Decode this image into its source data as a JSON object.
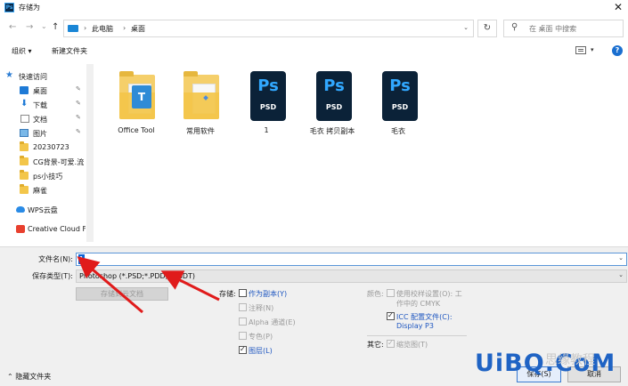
{
  "window": {
    "title": "存储为",
    "app_icon": "Ps",
    "close_glyph": "✕"
  },
  "nav": {
    "back": "←",
    "forward": "→",
    "recent": "⌄",
    "up": "↑"
  },
  "address": {
    "segments": [
      "此电脑",
      "桌面"
    ],
    "separator": "›",
    "dropdown": "⌄"
  },
  "refresh": "↻",
  "search": {
    "placeholder": "在 桌面 中搜索"
  },
  "toolbar": {
    "organize": "组织 ▾",
    "new_folder": "新建文件夹",
    "view_dropdown": "▾",
    "help": "?"
  },
  "sidebar": {
    "items": [
      {
        "label": "快速访问",
        "icon": "star-icon"
      },
      {
        "label": "桌面",
        "icon": "desktop-icon",
        "pinned": true
      },
      {
        "label": "下载",
        "icon": "download-icon",
        "pinned": true
      },
      {
        "label": "文档",
        "icon": "document-icon",
        "pinned": true
      },
      {
        "label": "图片",
        "icon": "picture-icon",
        "pinned": true
      },
      {
        "label": "20230723",
        "icon": "folder-icon"
      },
      {
        "label": "CG背景-可爱.流",
        "icon": "folder-icon"
      },
      {
        "label": "ps小技巧",
        "icon": "folder-icon"
      },
      {
        "label": "麻雀",
        "icon": "folder-icon"
      },
      {
        "label": "WPS云盘",
        "icon": "cloud-icon"
      },
      {
        "label": "Creative Cloud F",
        "icon": "creative-cloud-icon"
      }
    ],
    "pin_glyph": "📌"
  },
  "files": [
    {
      "name": "Office Tool",
      "type": "folder-app"
    },
    {
      "name": "常用软件",
      "type": "folder"
    },
    {
      "name": "1",
      "type": "psd"
    },
    {
      "name": "毛衣 拷贝副本",
      "type": "psd"
    },
    {
      "name": "毛衣",
      "type": "psd"
    }
  ],
  "psd_icon": {
    "ps": "Ps",
    "ext": "PSD",
    "color": "#31a8ff",
    "bg": "#0b2238"
  },
  "folder_badge": "T",
  "form": {
    "filename_label": "文件名(N):",
    "filename_value": "1",
    "filetype_label": "保存类型(T):",
    "filetype_value": "Photoshop (*.PSD;*.PDD;*.PSDT)",
    "cloud_button": "存储到云文档",
    "save_label": "存储:",
    "save_options": [
      {
        "label": "作为副本(Y)",
        "checked": false,
        "enabled": true
      },
      {
        "label": "注释(N)",
        "checked": false,
        "enabled": false
      },
      {
        "label": "Alpha 通道(E)",
        "checked": false,
        "enabled": false
      },
      {
        "label": "专色(P)",
        "checked": false,
        "enabled": false
      },
      {
        "label": "图层(L)",
        "checked": true,
        "enabled": true
      }
    ],
    "color_label": "颜色:",
    "proof_line1": "使用校样设置(O): 工",
    "proof_line2": "作中的 CMYK",
    "icc_line1": "ICC 配置文件(C):",
    "icc_line2": "Display P3",
    "other_label": "其它:",
    "thumbnail": "缩览图(T)",
    "hide_folders": "隐藏文件夹",
    "save_button": "保存(S)",
    "cancel_button": "取消"
  },
  "watermark": {
    "text": "UiBQ.CoM",
    "sub": "思缘教程"
  },
  "colors": {
    "accent": "#1e56c0",
    "arrow": "#e01b1b",
    "selection": "#0a64d6"
  }
}
